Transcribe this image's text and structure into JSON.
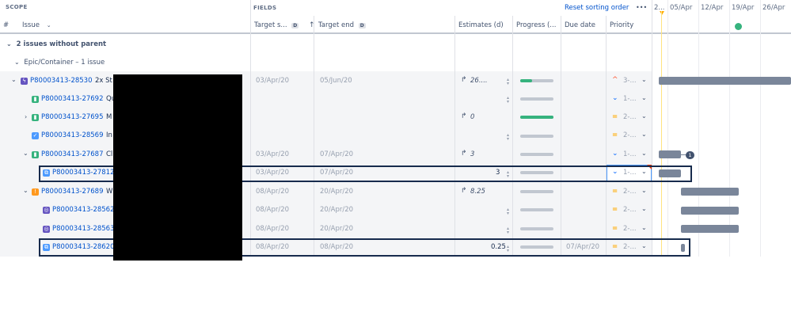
{
  "header": {
    "scope_label": "SCOPE",
    "fields_label": "FIELDS",
    "reset_sorting": "Reset sorting order",
    "more": "•••",
    "col_hash": "#",
    "col_issue": "Issue",
    "col_target_start": "Target s...",
    "col_target_start_badge": "D",
    "col_target_end": "Target end",
    "col_target_end_badge": "D",
    "col_estimates": "Estimates (d)",
    "col_progress": "Progress (...",
    "col_due": "Due date",
    "col_priority": "Priority"
  },
  "timeline": {
    "dates": [
      "2...",
      "05/Apr",
      "12/Apr",
      "19/Apr",
      "26/Apr"
    ]
  },
  "groups": {
    "no_parent": "2 issues without parent",
    "epic_container": "Epic/Container – 1 issue"
  },
  "rows": [
    {
      "key": "P80003413-28530",
      "summary": "2x St",
      "icon": "lightning-icon",
      "icon_color": "#6554c0",
      "start": "03/Apr/20",
      "end": "05/Jun/20",
      "estimate": "26....",
      "estimate_rollup": true,
      "progress": 0.35,
      "due": "",
      "priority": "3-...",
      "priority_icon": "priority-high-icon"
    },
    {
      "key": "P80003413-27692",
      "summary": "Qu",
      "icon": "story-icon",
      "icon_color": "#36b37e",
      "start": "",
      "end": "",
      "estimate": "",
      "estimate_rollup": false,
      "progress": 0,
      "due": "",
      "priority": "1-...",
      "priority_icon": "priority-low-icon"
    },
    {
      "key": "P80003413-27695",
      "summary": "M",
      "icon": "story-icon",
      "icon_color": "#36b37e",
      "start": "",
      "end": "",
      "estimate": "0",
      "estimate_rollup": true,
      "progress": 1.0,
      "due": "",
      "priority": "2-...",
      "priority_icon": "priority-medium-icon"
    },
    {
      "key": "P80003413-28569",
      "summary": "In",
      "icon": "task-icon",
      "icon_color": "#4c9aff",
      "start": "",
      "end": "",
      "estimate": "",
      "estimate_rollup": false,
      "progress": 0,
      "due": "",
      "priority": "2-...",
      "priority_icon": "priority-medium-icon"
    },
    {
      "key": "P80003413-27687",
      "summary": "Cl",
      "icon": "story-icon",
      "icon_color": "#36b37e",
      "start": "03/Apr/20",
      "end": "07/Apr/20",
      "estimate": "3",
      "estimate_rollup": true,
      "progress": 0,
      "due": "",
      "priority": "1-...",
      "priority_icon": "priority-low-icon",
      "badge": "1"
    },
    {
      "key": "P80003413-27812",
      "summary": "",
      "icon": "subtask-icon",
      "icon_color": "#4c9aff",
      "start": "03/Apr/20",
      "end": "07/Apr/20",
      "estimate": "3",
      "estimate_rollup": false,
      "progress": 0,
      "due": "",
      "priority": "1-...",
      "priority_icon": "priority-low-icon"
    },
    {
      "key": "P80003413-27689",
      "summary": "W",
      "icon": "bug-icon",
      "icon_color": "#ff991f",
      "start": "08/Apr/20",
      "end": "20/Apr/20",
      "estimate": "8.25",
      "estimate_rollup": true,
      "progress": 0,
      "due": "",
      "priority": "2-...",
      "priority_icon": "priority-medium-icon"
    },
    {
      "key": "P80003413-28562",
      "summary": "",
      "icon": "subtask-icon",
      "icon_color": "#6554c0",
      "start": "08/Apr/20",
      "end": "20/Apr/20",
      "estimate": "",
      "estimate_rollup": false,
      "progress": 0,
      "due": "",
      "priority": "2-...",
      "priority_icon": "priority-medium-icon"
    },
    {
      "key": "P80003413-28563",
      "summary": "",
      "icon": "subtask-icon",
      "icon_color": "#6554c0",
      "start": "08/Apr/20",
      "end": "20/Apr/20",
      "estimate": "",
      "estimate_rollup": false,
      "progress": 0,
      "due": "",
      "priority": "2-...",
      "priority_icon": "priority-medium-icon"
    },
    {
      "key": "P80003413-28620",
      "summary": "",
      "icon": "subtask-icon",
      "icon_color": "#4c9aff",
      "start": "08/Apr/20",
      "end": "08/Apr/20",
      "estimate": "0.25",
      "estimate_rollup": false,
      "progress": 0,
      "due": "07/Apr/20",
      "priority": "2-...",
      "priority_icon": "priority-medium-icon"
    }
  ]
}
